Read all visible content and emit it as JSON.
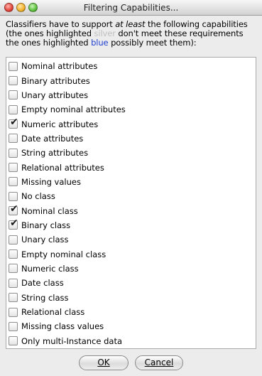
{
  "window": {
    "title": "Filtering Capabilities..."
  },
  "intro": {
    "part1": "Classifiers have to support ",
    "emph": "at least",
    "part2": " the following capabilities",
    "line2_a": "(the ones highlighted ",
    "silver_word": "silver",
    "line2_b": " don't meet these requirements",
    "line3_a": "the ones highlighted ",
    "blue_word": "blue",
    "line3_b": " possibly meet them):"
  },
  "capabilities": [
    {
      "label": "Nominal attributes",
      "checked": false
    },
    {
      "label": "Binary attributes",
      "checked": false
    },
    {
      "label": "Unary attributes",
      "checked": false
    },
    {
      "label": "Empty nominal attributes",
      "checked": false
    },
    {
      "label": "Numeric attributes",
      "checked": true
    },
    {
      "label": "Date attributes",
      "checked": false
    },
    {
      "label": "String attributes",
      "checked": false
    },
    {
      "label": "Relational attributes",
      "checked": false
    },
    {
      "label": "Missing values",
      "checked": false
    },
    {
      "label": "No class",
      "checked": false
    },
    {
      "label": "Nominal class",
      "checked": true
    },
    {
      "label": "Binary class",
      "checked": true
    },
    {
      "label": "Unary class",
      "checked": false
    },
    {
      "label": "Empty nominal class",
      "checked": false
    },
    {
      "label": "Numeric class",
      "checked": false
    },
    {
      "label": "Date class",
      "checked": false
    },
    {
      "label": "String class",
      "checked": false
    },
    {
      "label": "Relational class",
      "checked": false
    },
    {
      "label": "Missing class values",
      "checked": false
    },
    {
      "label": "Only multi-Instance data",
      "checked": false
    }
  ],
  "buttons": {
    "ok": "OK",
    "cancel": "Cancel"
  },
  "colors": {
    "silver": "#c0c0c0",
    "blue": "#1f3fd0"
  }
}
